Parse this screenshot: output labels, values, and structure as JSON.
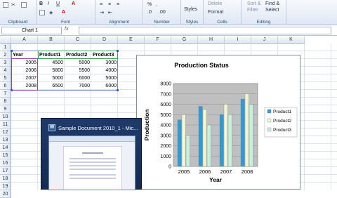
{
  "ribbon": {
    "groups": [
      {
        "label": "Clipboard"
      },
      {
        "label": "Font"
      },
      {
        "label": "Alignment"
      },
      {
        "label": "Number"
      },
      {
        "label": "Styles"
      },
      {
        "label": "Cells"
      },
      {
        "label": "Editing"
      }
    ],
    "styles_label": "Styles",
    "delete_label": "Delete",
    "format_label": "Format",
    "sort_filter_label": "Sort &",
    "filter_label": "Filter",
    "find_select_label": "Find &",
    "select_label": "Select",
    "bold": "B",
    "italic": "I",
    "underline": "U"
  },
  "formula_bar": {
    "name_box": "Chart 1",
    "fx": "fx",
    "value": ""
  },
  "columns": [
    "A",
    "B",
    "C",
    "D",
    "E",
    "F",
    "G",
    "H",
    "I",
    "J",
    "K"
  ],
  "rows": [
    "1",
    "2",
    "3",
    "4",
    "5",
    "6",
    "7",
    "8",
    "9",
    "10",
    "11",
    "12",
    "13",
    "14",
    "15",
    "16",
    "17",
    "18",
    "19",
    "20"
  ],
  "table": {
    "headers": [
      "Year",
      "Product1",
      "Product2",
      "Product3"
    ],
    "rows": [
      [
        "2005",
        "4500",
        "5000",
        "3000"
      ],
      [
        "2006",
        "5800",
        "5500",
        "4000"
      ],
      [
        "2007",
        "5000",
        "6000",
        "5000"
      ],
      [
        "2008",
        "6500",
        "7000",
        "6000"
      ]
    ]
  },
  "chart_data": {
    "type": "bar",
    "title": "Production Status",
    "xlabel": "Year",
    "ylabel": "Production",
    "categories": [
      "2005",
      "2006",
      "2007",
      "2008"
    ],
    "series": [
      {
        "name": "Product1",
        "values": [
          4500,
          5800,
          5000,
          6500
        ],
        "color": "#2e9bd6"
      },
      {
        "name": "Product2",
        "values": [
          5000,
          5500,
          6000,
          7000
        ],
        "color": "#f4f4d0"
      },
      {
        "name": "Product3",
        "values": [
          3000,
          4000,
          5000,
          6000
        ],
        "color": "#c9f0dc"
      }
    ],
    "ylim": [
      0,
      8000
    ],
    "yticks": [
      "0",
      "1000",
      "2000",
      "3000",
      "4000",
      "5000",
      "6000",
      "7000",
      "8000"
    ],
    "legend": "right",
    "plot_background": "#bfbfbf",
    "grid": true
  },
  "thumbnail": {
    "title": "Sample Document 2010_1 - Mic..."
  }
}
